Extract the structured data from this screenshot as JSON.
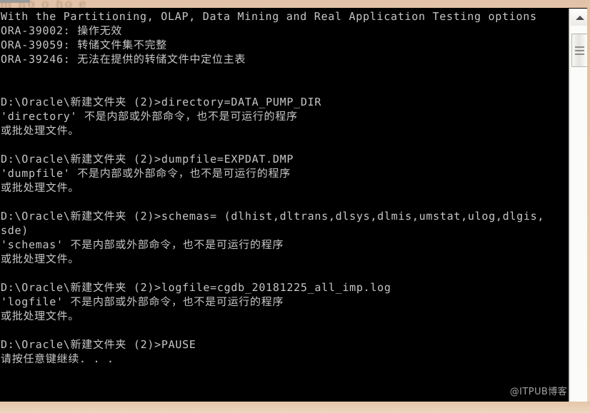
{
  "window": {
    "type": "windows-command-prompt",
    "background_color": "#000000",
    "text_color": "#c6c6c6",
    "desktop_color": "#e9cdb4"
  },
  "console": {
    "lines": [
      "With the Partitioning, OLAP, Data Mining and Real Application Testing options",
      "ORA-39002: 操作无效",
      "ORA-39059: 转储文件集不完整",
      "ORA-39246: 无法在提供的转储文件中定位主表",
      "",
      "",
      "D:\\Oracle\\新建文件夹 (2)>directory=DATA_PUMP_DIR",
      "'directory' 不是内部或外部命令，也不是可运行的程序",
      "或批处理文件。",
      "",
      "D:\\Oracle\\新建文件夹 (2)>dumpfile=EXPDAT.DMP",
      "'dumpfile' 不是内部或外部命令，也不是可运行的程序",
      "或批处理文件。",
      "",
      "D:\\Oracle\\新建文件夹 (2)>schemas= (dlhist,dltrans,dlsys,dlmis,umstat,ulog,dlgis,",
      "sde)",
      "'schemas' 不是内部或外部命令，也不是可运行的程序",
      "或批处理文件。",
      "",
      "D:\\Oracle\\新建文件夹 (2)>logfile=cgdb_20181225_all_imp.log",
      "'logfile' 不是内部或外部命令，也不是可运行的程序",
      "或批处理文件。",
      "",
      "D:\\Oracle\\新建文件夹 (2)>PAUSE",
      "请按任意键继续. . ."
    ],
    "prompt_path": "D:\\Oracle\\新建文件夹 (2)>",
    "commands_entered": [
      "directory=DATA_PUMP_DIR",
      "dumpfile=EXPDAT.DMP",
      "schemas= (dlhist,dltrans,dlsys,dlmis,umstat,ulog,dlgis,sde)",
      "logfile=cgdb_20181225_all_imp.log",
      "PAUSE"
    ],
    "oracle_errors": [
      {
        "code": "ORA-39002",
        "message": "操作无效"
      },
      {
        "code": "ORA-39059",
        "message": "转储文件集不完整"
      },
      {
        "code": "ORA-39246",
        "message": "无法在提供的转储文件中定位主表"
      }
    ],
    "schemas_list": [
      "dlhist",
      "dltrans",
      "dlsys",
      "dlmis",
      "umstat",
      "ulog",
      "dlgis",
      "sde"
    ],
    "error_text_template": "不是内部或外部命令，也不是可运行的程序",
    "error_text_second_line": "或批处理文件。",
    "pause_message": "请按任意键继续. . ."
  },
  "scrollbar": {
    "up_arrow": "scroll-up-arrow",
    "thumb_grip_count": 3,
    "orientation": "vertical"
  },
  "watermark": {
    "text": "@ITPUB博客"
  },
  "bg_bleed": {
    "text": "  m   no o             ho  e"
  }
}
